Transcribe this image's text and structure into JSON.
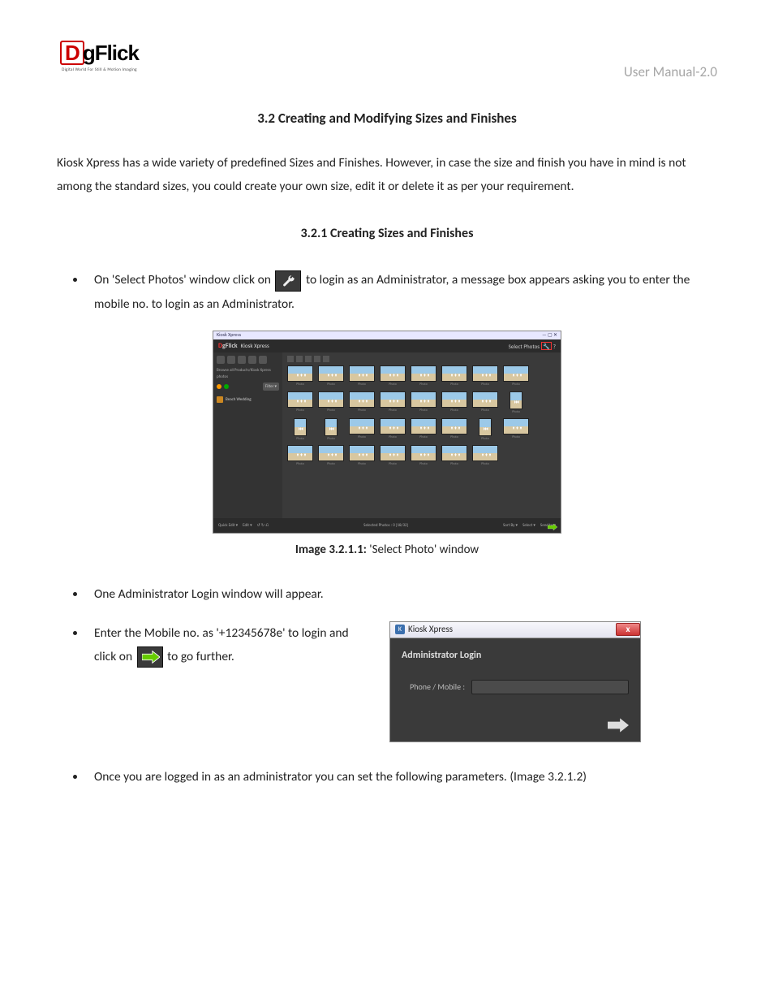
{
  "header": {
    "logo_text": "gFlick",
    "logo_sub": "Digital World For Still & Motion Imaging",
    "right": "User Manual-2.0"
  },
  "section_heading": "3.2 Creating and Modifying Sizes and Finishes",
  "intro": "Kiosk Xpress has a wide variety of predefined Sizes and Finishes. However, in case the size and finish you have in mind is not among the standard sizes, you could create your own size, edit it or delete it as per your requirement.",
  "subheading": "3.2.1 Creating Sizes and Finishes",
  "bullets": {
    "b1_pre": "On 'Select Photos' window click on ",
    "b1_post": " to login as an Administrator, a message box appears asking you to enter the mobile no. to login as an Administrator.",
    "b2": "One Administrator Login window will appear.",
    "b3_pre": "Enter the Mobile no. as '+12345678e' to login and click on ",
    "b3_post": " to go further.",
    "b4": "Once you are logged in as an administrator you can set the following parameters. (Image 3.2.1.2)"
  },
  "caption1_bold": "Image 3.2.1.1:",
  "caption1_rest": " 'Select Photo' window",
  "shot1": {
    "titlebar_left": "Kiosk Xpress",
    "brand_sub": "Kiosk Xpress",
    "brand_right_label": "Select Photos",
    "sidebar_hint": "Browse all Products/Kiosk Xpress photos",
    "sidebar_filter": "Filter ▾",
    "sidebar_folder": "Beach Wedding",
    "bottom_left_a": "Quick Edit ▾",
    "bottom_left_b": "Edit ▾",
    "bottom_mid_label": "Selected Photos :",
    "bottom_mid_count": "0   [18/32]",
    "bottom_right_a": "Sort By ▾",
    "bottom_right_b": "Select ▾",
    "bottom_right_c": "Send to ▾"
  },
  "shot2": {
    "win_title": "Kiosk Xpress",
    "close": "x",
    "heading": "Administrator Login",
    "field_label": "Phone / Mobile :"
  }
}
